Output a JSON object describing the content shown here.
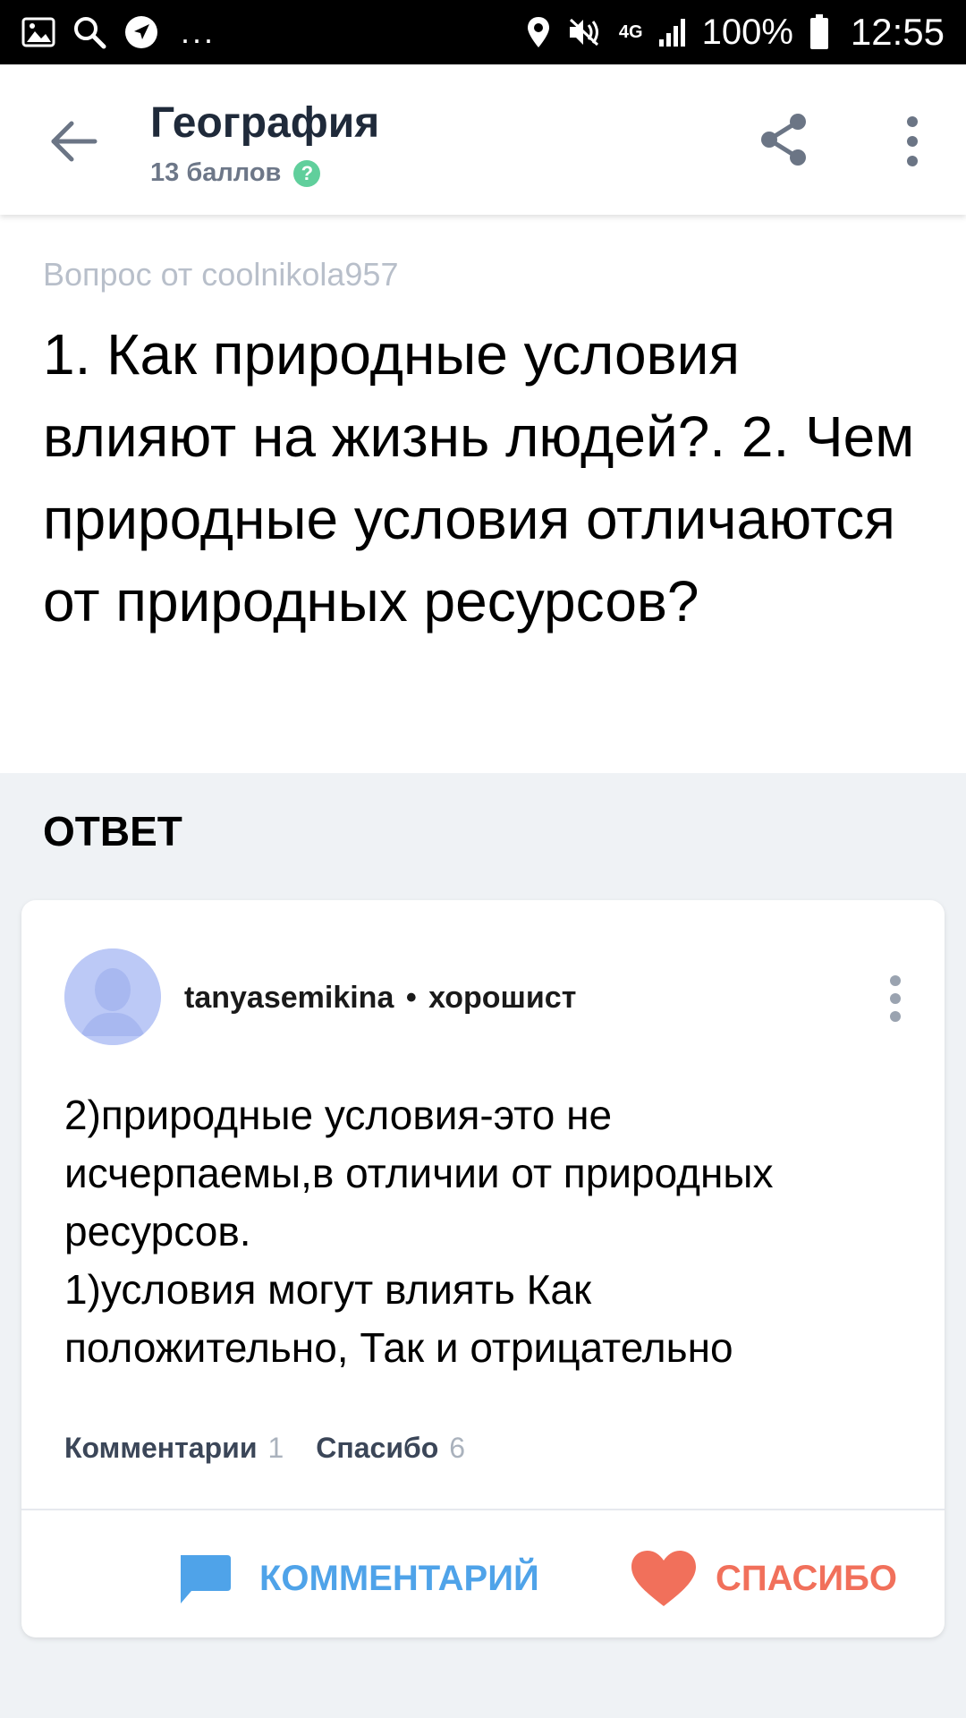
{
  "status_bar": {
    "network": "4G",
    "battery": "100%",
    "time": "12:55",
    "dots": "..."
  },
  "app_bar": {
    "title": "География",
    "points": "13 баллов",
    "help_glyph": "?"
  },
  "question": {
    "meta": "Вопрос от coolnikola957",
    "text": "1. Как природные условия влияют на жизнь людей?. 2. Чем природные условия отличаются от природных ресурсов?"
  },
  "answer_section": {
    "heading": "ОТВЕТ"
  },
  "answer": {
    "author": "tanyasemikina",
    "separator": "•",
    "rank": "хорошист",
    "lines": [
      "2)природные условия-это не",
      "исчерпаемы,в отличии от природных",
      "ресурсов.",
      "1)условия могут влиять Как",
      "положительно, Так и отрицательно"
    ],
    "comments_label": "Комментарии",
    "comments_count": "1",
    "thanks_label": "Спасибо",
    "thanks_count": "6",
    "comment_action": "КОММЕНТАРИЙ",
    "thanks_action": "СПАСИБО"
  },
  "colors": {
    "accent_blue": "#4fa3e9",
    "accent_red": "#f1705b",
    "help_green": "#60cf9c",
    "avatar_bg": "#bcc9f6",
    "page_bg": "#eff2f5"
  },
  "icons": {
    "status_left": [
      "gallery-icon",
      "search-icon",
      "navigation-icon"
    ],
    "status_right": [
      "location-icon",
      "mute-icon",
      "signal-icon",
      "battery-icon"
    ],
    "app_bar": [
      "back-arrow-icon",
      "share-icon",
      "more-vert-icon"
    ],
    "answer": [
      "avatar-icon",
      "more-vert-icon",
      "comment-icon",
      "heart-icon"
    ]
  }
}
